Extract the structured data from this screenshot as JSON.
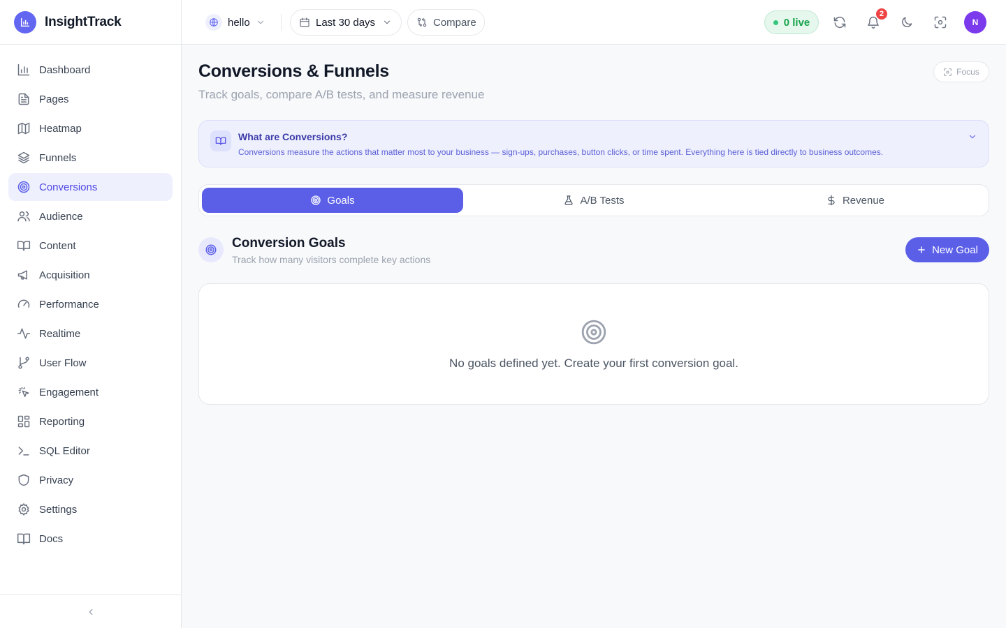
{
  "brand": {
    "name": "InsightTrack",
    "accent": "#6366f1"
  },
  "sidebar": {
    "items": [
      {
        "label": "Dashboard",
        "icon": "bar-chart-icon"
      },
      {
        "label": "Pages",
        "icon": "file-text-icon"
      },
      {
        "label": "Heatmap",
        "icon": "map-icon"
      },
      {
        "label": "Funnels",
        "icon": "layers-icon"
      },
      {
        "label": "Conversions",
        "icon": "target-icon",
        "active": true
      },
      {
        "label": "Audience",
        "icon": "users-icon"
      },
      {
        "label": "Content",
        "icon": "book-open-icon"
      },
      {
        "label": "Acquisition",
        "icon": "megaphone-icon"
      },
      {
        "label": "Performance",
        "icon": "gauge-icon"
      },
      {
        "label": "Realtime",
        "icon": "activity-icon"
      },
      {
        "label": "User Flow",
        "icon": "git-branch-icon"
      },
      {
        "label": "Engagement",
        "icon": "pointer-click-icon"
      },
      {
        "label": "Reporting",
        "icon": "layout-grid-icon"
      },
      {
        "label": "SQL Editor",
        "icon": "terminal-icon"
      },
      {
        "label": "Privacy",
        "icon": "shield-icon"
      },
      {
        "label": "Settings",
        "icon": "gear-icon"
      },
      {
        "label": "Docs",
        "icon": "book-icon"
      }
    ],
    "collapse_icon": "chevron-left-icon"
  },
  "topbar": {
    "site": "hello",
    "date_range": "Last 30 days",
    "compare_label": "Compare",
    "live_label": "0 live",
    "notifications_count": "2",
    "avatar_initial": "N"
  },
  "page": {
    "title": "Conversions & Funnels",
    "subtitle": "Track goals, compare A/B tests, and measure revenue",
    "focus_label": "Focus"
  },
  "info": {
    "title": "What are Conversions?",
    "body": "Conversions measure the actions that matter most to your business — sign-ups, purchases, button clicks, or time spent. Everything here is tied directly to business outcomes."
  },
  "tabs": [
    {
      "label": "Goals",
      "icon": "target-icon",
      "active": true
    },
    {
      "label": "A/B Tests",
      "icon": "flask-icon"
    },
    {
      "label": "Revenue",
      "icon": "dollar-icon"
    }
  ],
  "section": {
    "title": "Conversion Goals",
    "subtitle": "Track how many visitors complete key actions",
    "new_button": "New Goal"
  },
  "empty": {
    "message": "No goals defined yet. Create your first conversion goal."
  }
}
